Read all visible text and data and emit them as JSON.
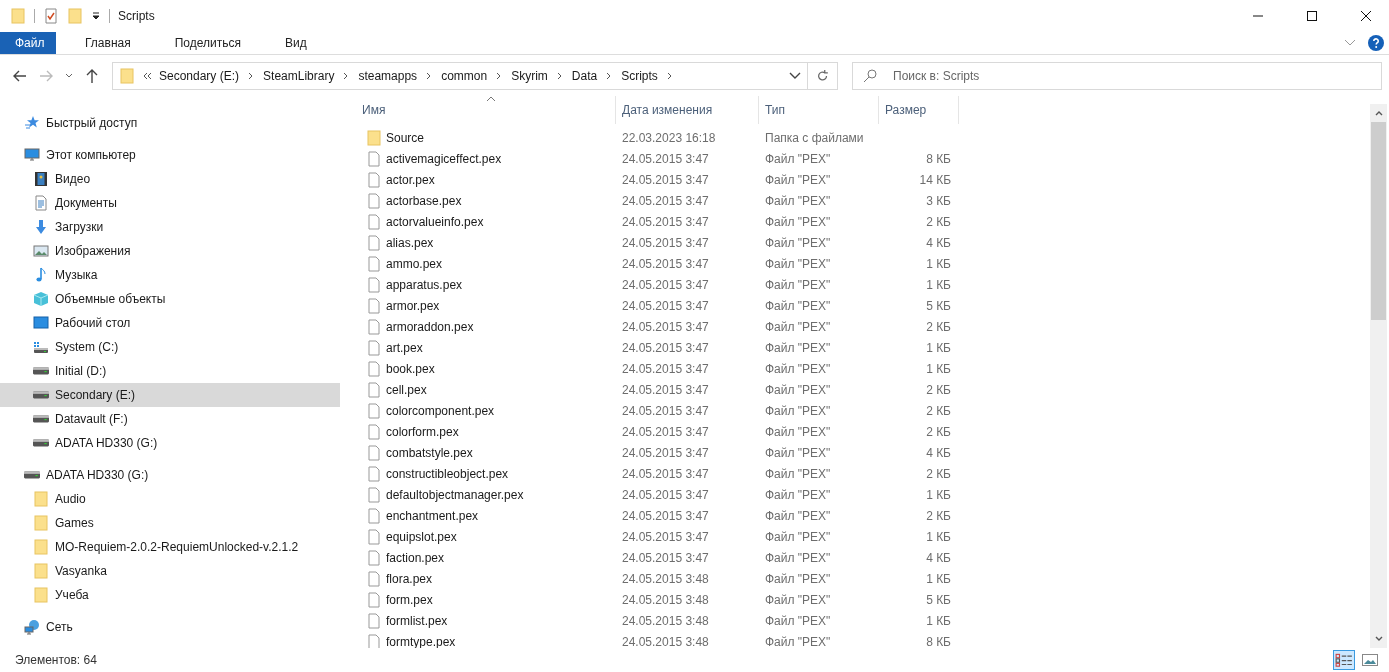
{
  "window": {
    "title": "Scripts"
  },
  "ribbon_tabs": [
    {
      "label": "Файл",
      "kind": "file"
    },
    {
      "label": "Главная",
      "kind": "tab"
    },
    {
      "label": "Поделиться",
      "kind": "tab"
    },
    {
      "label": "Вид",
      "kind": "tab"
    }
  ],
  "address_bar": {
    "crumbs": [
      "Secondary (E:)",
      "SteamLibrary",
      "steamapps",
      "common",
      "Skyrim",
      "Data",
      "Scripts"
    ]
  },
  "search": {
    "placeholder": "Поиск в: Scripts"
  },
  "sidebar": {
    "items": [
      {
        "label": "Быстрый доступ",
        "kind": "star",
        "selected": false
      },
      {
        "label": "Этот компьютер",
        "kind": "monitor",
        "selected": false,
        "children": [
          {
            "label": "Видео",
            "kind": "film",
            "selected": false
          },
          {
            "label": "Документы",
            "kind": "document",
            "selected": false
          },
          {
            "label": "Загрузки",
            "kind": "download",
            "selected": false
          },
          {
            "label": "Изображения",
            "kind": "picture",
            "selected": false
          },
          {
            "label": "Музыка",
            "kind": "music",
            "selected": false
          },
          {
            "label": "Объемные объекты",
            "kind": "cube",
            "selected": false
          },
          {
            "label": "Рабочий стол",
            "kind": "desktop",
            "selected": false
          },
          {
            "label": "System (C:)",
            "kind": "windrive",
            "selected": false
          },
          {
            "label": "Initial (D:)",
            "kind": "drive",
            "selected": false
          },
          {
            "label": "Secondary (E:)",
            "kind": "drive",
            "selected": true
          },
          {
            "label": "Datavault (F:)",
            "kind": "drive",
            "selected": false
          },
          {
            "label": "ADATA HD330 (G:)",
            "kind": "drive",
            "selected": false
          }
        ]
      },
      {
        "label": "ADATA HD330 (G:)",
        "kind": "drive",
        "selected": false,
        "children": [
          {
            "label": "Audio",
            "kind": "folder",
            "selected": false
          },
          {
            "label": "Games",
            "kind": "folder",
            "selected": false
          },
          {
            "label": "MO-Requiem-2.0.2-RequiemUnlocked-v.2.1.2",
            "kind": "folder",
            "selected": false
          },
          {
            "label": "Vasyanka",
            "kind": "folder",
            "selected": false
          },
          {
            "label": "Учеба",
            "kind": "folder",
            "selected": false
          }
        ]
      },
      {
        "label": "Сеть",
        "kind": "network",
        "selected": false
      }
    ]
  },
  "table": {
    "columns": [
      {
        "label": "Имя",
        "sorted": true
      },
      {
        "label": "Дата изменения",
        "sorted": false
      },
      {
        "label": "Тип",
        "sorted": false
      },
      {
        "label": "Размер",
        "sorted": false
      }
    ],
    "rows": [
      {
        "kind": "folder",
        "name": "Source",
        "date": "22.03.2023 16:18",
        "type": "Папка с файлами"
      },
      {
        "kind": "file",
        "name": "activemagiceffect.pex",
        "date": "24.05.2015 3:47",
        "type": "Файл \"PEX\"",
        "size": "8 КБ"
      },
      {
        "kind": "file",
        "name": "actor.pex",
        "date": "24.05.2015 3:47",
        "type": "Файл \"PEX\"",
        "size": "14 КБ"
      },
      {
        "kind": "file",
        "name": "actorbase.pex",
        "date": "24.05.2015 3:47",
        "type": "Файл \"PEX\"",
        "size": "3 КБ"
      },
      {
        "kind": "file",
        "name": "actorvalueinfo.pex",
        "date": "24.05.2015 3:47",
        "type": "Файл \"PEX\"",
        "size": "2 КБ"
      },
      {
        "kind": "file",
        "name": "alias.pex",
        "date": "24.05.2015 3:47",
        "type": "Файл \"PEX\"",
        "size": "4 КБ"
      },
      {
        "kind": "file",
        "name": "ammo.pex",
        "date": "24.05.2015 3:47",
        "type": "Файл \"PEX\"",
        "size": "1 КБ"
      },
      {
        "kind": "file",
        "name": "apparatus.pex",
        "date": "24.05.2015 3:47",
        "type": "Файл \"PEX\"",
        "size": "1 КБ"
      },
      {
        "kind": "file",
        "name": "armor.pex",
        "date": "24.05.2015 3:47",
        "type": "Файл \"PEX\"",
        "size": "5 КБ"
      },
      {
        "kind": "file",
        "name": "armoraddon.pex",
        "date": "24.05.2015 3:47",
        "type": "Файл \"PEX\"",
        "size": "2 КБ"
      },
      {
        "kind": "file",
        "name": "art.pex",
        "date": "24.05.2015 3:47",
        "type": "Файл \"PEX\"",
        "size": "1 КБ"
      },
      {
        "kind": "file",
        "name": "book.pex",
        "date": "24.05.2015 3:47",
        "type": "Файл \"PEX\"",
        "size": "1 КБ"
      },
      {
        "kind": "file",
        "name": "cell.pex",
        "date": "24.05.2015 3:47",
        "type": "Файл \"PEX\"",
        "size": "2 КБ"
      },
      {
        "kind": "file",
        "name": "colorcomponent.pex",
        "date": "24.05.2015 3:47",
        "type": "Файл \"PEX\"",
        "size": "2 КБ"
      },
      {
        "kind": "file",
        "name": "colorform.pex",
        "date": "24.05.2015 3:47",
        "type": "Файл \"PEX\"",
        "size": "2 КБ"
      },
      {
        "kind": "file",
        "name": "combatstyle.pex",
        "date": "24.05.2015 3:47",
        "type": "Файл \"PEX\"",
        "size": "4 КБ"
      },
      {
        "kind": "file",
        "name": "constructibleobject.pex",
        "date": "24.05.2015 3:47",
        "type": "Файл \"PEX\"",
        "size": "2 КБ"
      },
      {
        "kind": "file",
        "name": "defaultobjectmanager.pex",
        "date": "24.05.2015 3:47",
        "type": "Файл \"PEX\"",
        "size": "1 КБ"
      },
      {
        "kind": "file",
        "name": "enchantment.pex",
        "date": "24.05.2015 3:47",
        "type": "Файл \"PEX\"",
        "size": "2 КБ"
      },
      {
        "kind": "file",
        "name": "equipslot.pex",
        "date": "24.05.2015 3:47",
        "type": "Файл \"PEX\"",
        "size": "1 КБ"
      },
      {
        "kind": "file",
        "name": "faction.pex",
        "date": "24.05.2015 3:47",
        "type": "Файл \"PEX\"",
        "size": "4 КБ"
      },
      {
        "kind": "file",
        "name": "flora.pex",
        "date": "24.05.2015 3:48",
        "type": "Файл \"PEX\"",
        "size": "1 КБ"
      },
      {
        "kind": "file",
        "name": "form.pex",
        "date": "24.05.2015 3:48",
        "type": "Файл \"PEX\"",
        "size": "5 КБ"
      },
      {
        "kind": "file",
        "name": "formlist.pex",
        "date": "24.05.2015 3:48",
        "type": "Файл \"PEX\"",
        "size": "1 КБ"
      },
      {
        "kind": "file",
        "name": "formtype.pex",
        "date": "24.05.2015 3:48",
        "type": "Файл \"PEX\"",
        "size": "8 КБ"
      }
    ]
  },
  "status_bar": {
    "count": "Элементов: 64"
  },
  "view_buttons": [
    {
      "kind": "details",
      "selected": true
    },
    {
      "kind": "thumbnails",
      "selected": false
    }
  ]
}
